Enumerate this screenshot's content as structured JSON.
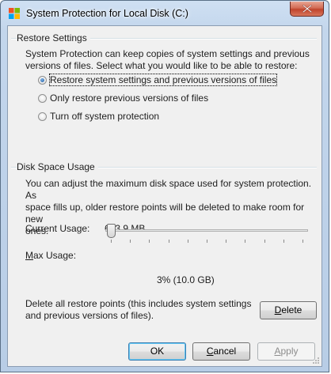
{
  "window": {
    "title": "System Protection for Local Disk (C:)",
    "icon": "windows-shield-icon",
    "close_icon": "close-icon"
  },
  "restore_settings": {
    "group_title": "Restore Settings",
    "description_line1": "System Protection can keep copies of system settings and previous",
    "description_line2": "versions of files. Select what you would like to be able to restore:",
    "options": [
      {
        "label": "Restore system settings and previous versions of files",
        "selected": true
      },
      {
        "label": "Only restore previous versions of files",
        "selected": false
      },
      {
        "label": "Turn off system protection",
        "selected": false
      }
    ]
  },
  "disk_space": {
    "group_title": "Disk Space Usage",
    "description_line1": "You can adjust the maximum disk space used for system protection. As",
    "description_line2": "space fills up, older restore points will be deleted to make room for new",
    "description_line3": "ones.",
    "current_usage_label": "Current Usage:",
    "current_usage_value": "683.9 MB",
    "max_usage_label": "Max Usage:",
    "max_usage_value": "3% (10.0 GB)",
    "max_usage_fraction": 0.03,
    "delete_text_line1": "Delete all restore points (this includes system settings",
    "delete_text_line2": "and previous versions of files).",
    "delete_button": "Delete"
  },
  "buttons": {
    "ok": "OK",
    "cancel": "Cancel",
    "apply": "Apply"
  },
  "colors": {
    "accent": "#3c7fb1",
    "close_red": "#c0442c"
  }
}
